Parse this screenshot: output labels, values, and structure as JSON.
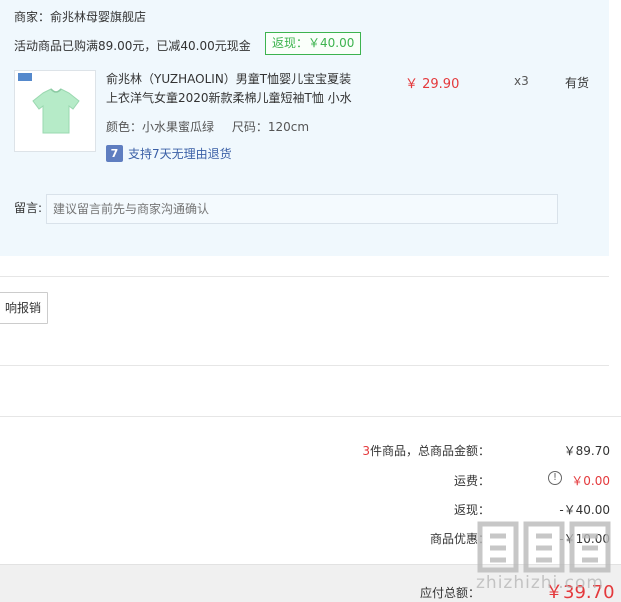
{
  "shop": {
    "merchant": "商家：俞兆林母婴旗舰店",
    "promo": "活动商品已购满89.00元，已减40.00元现金",
    "rebate_badge": "返现：￥40.00"
  },
  "product": {
    "name": "俞兆林（YUZHAOLIN）男童T恤婴儿宝宝夏装上衣洋气女童2020新款柔棉儿童短袖T恤 小水",
    "color": "颜色：小水果蜜瓜绿",
    "size": "尺码：120cm",
    "return_policy_icon": "7",
    "return_policy": "支持7天无理由退货",
    "price": "￥ 29.90",
    "quantity": "x3",
    "stock": "有货",
    "image_icon": "tshirt-image"
  },
  "message": {
    "label": "留言:",
    "placeholder": "建议留言前先与商家沟通确认"
  },
  "invoice": {
    "button_label": "响报销"
  },
  "summary": {
    "count": "3",
    "count_suffix": "件商品，总商品金额：",
    "total_goods": "￥89.70",
    "shipping_label": "运费：",
    "shipping_value": "￥0.00",
    "rebate_label": "返现：",
    "rebate_value": "-￥40.00",
    "discount_label": "商品优惠：",
    "discount_value": "-￥10.00",
    "payable_label": "应付总额：",
    "payable_value": "￥39.70"
  },
  "watermark": {
    "text": "zhizhizhi.com"
  },
  "colors": {
    "panel_bg": "#f0f8fd",
    "accent_red": "#e4393c",
    "badge_green": "#3db34f",
    "link_blue": "#3a5fa6"
  }
}
